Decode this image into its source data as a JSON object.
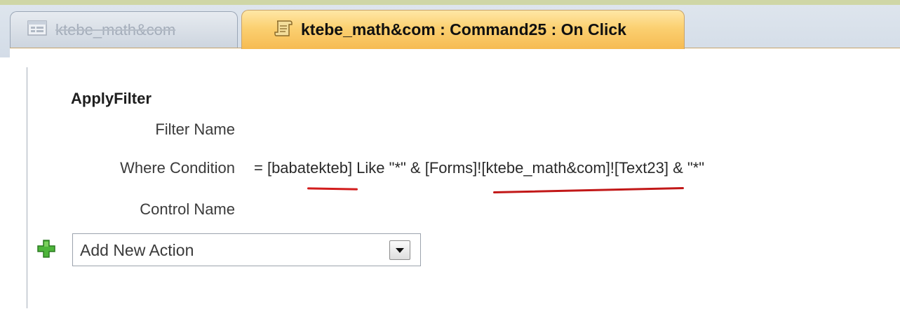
{
  "tabs": [
    {
      "label": "ktebe_math&com",
      "icon": "form-icon",
      "active": false
    },
    {
      "label": "ktebe_math&com : Command25 : On Click",
      "icon": "macro-scroll-icon",
      "active": true
    }
  ],
  "macro": {
    "action": "ApplyFilter",
    "arguments": [
      {
        "label": "Filter Name",
        "value": ""
      },
      {
        "label": "Where Condition",
        "value": "= [babatekteb] Like \"*\" & [Forms]![ktebe_math&com]![Text23] & \"*\""
      },
      {
        "label": "Control Name",
        "value": ""
      }
    ]
  },
  "add_action": {
    "placeholder": "Add New Action",
    "icon": "plus-icon",
    "dropdown_icon": "chevron-down-icon"
  },
  "colors": {
    "active_tab": "#f9c865",
    "annotation_underline": "#d21c1c"
  }
}
